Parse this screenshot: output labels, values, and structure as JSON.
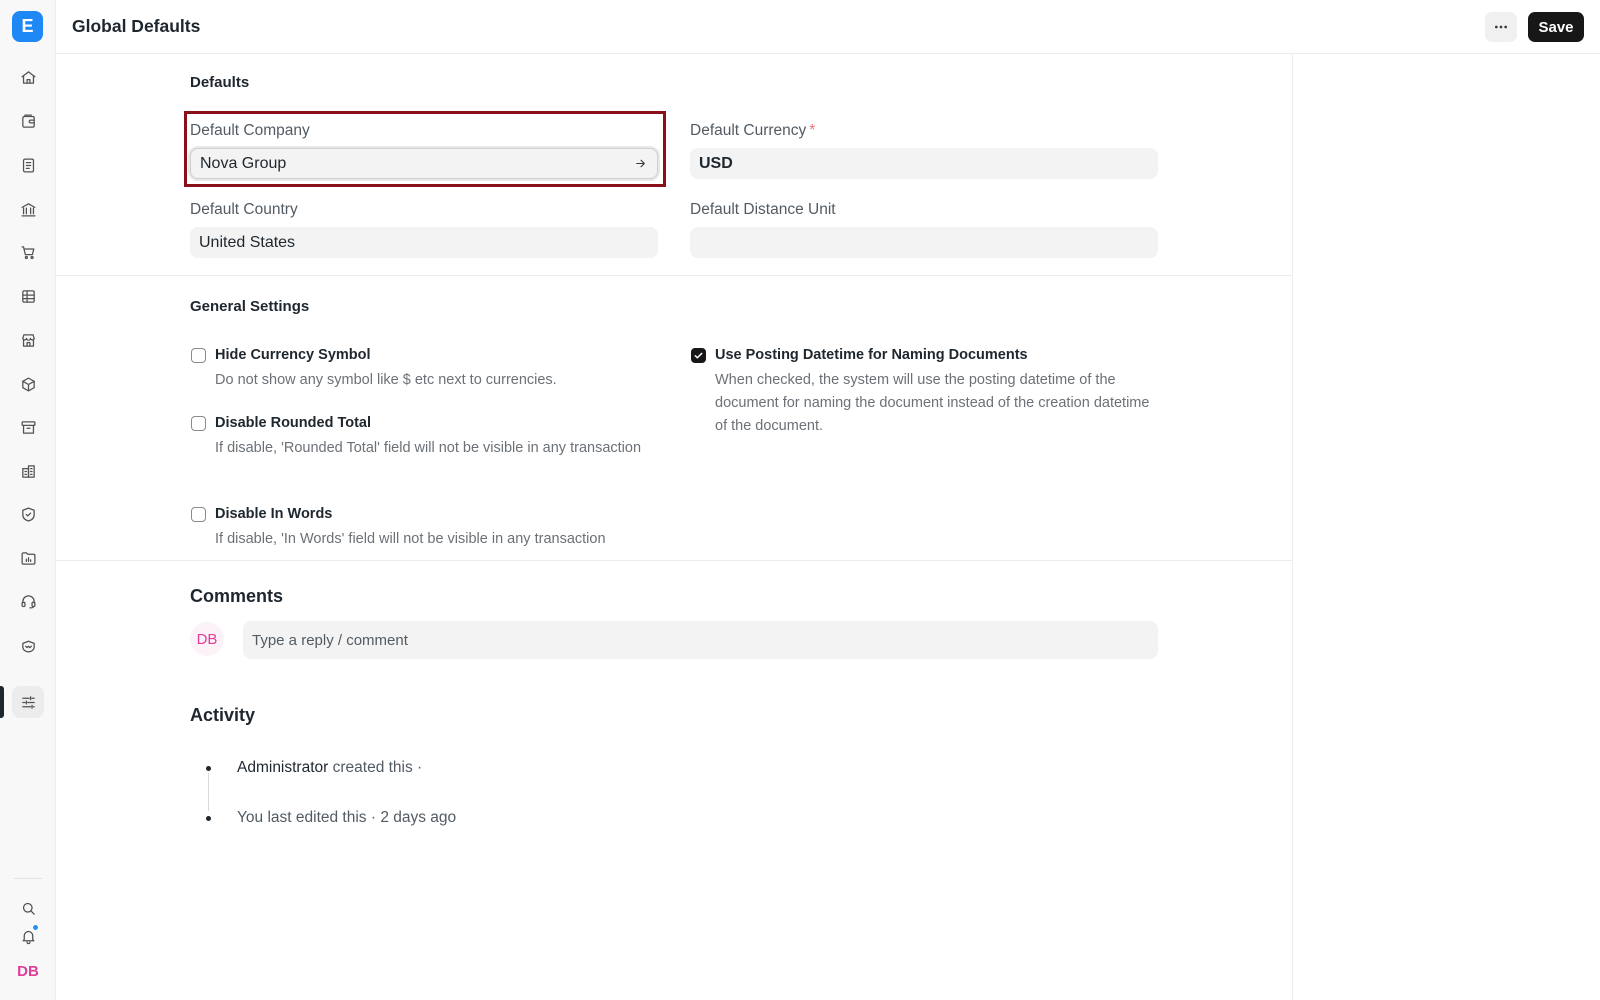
{
  "app": {
    "logo_letter": "E",
    "user_initials": "DB"
  },
  "sidebar": {
    "items": [
      {
        "name": "home-icon"
      },
      {
        "name": "wallet-icon"
      },
      {
        "name": "document-icon"
      },
      {
        "name": "bank-icon"
      },
      {
        "name": "cart-icon"
      },
      {
        "name": "table-icon"
      },
      {
        "name": "store-icon"
      },
      {
        "name": "package-icon"
      },
      {
        "name": "archive-icon"
      },
      {
        "name": "building-icon"
      },
      {
        "name": "shield-icon"
      },
      {
        "name": "folder-chart-icon"
      },
      {
        "name": "headset-icon"
      },
      {
        "name": "handshake-icon"
      },
      {
        "name": "sliders-icon",
        "active": true
      }
    ]
  },
  "header": {
    "title": "Global Defaults",
    "more_label": "···",
    "save_label": "Save"
  },
  "defaults": {
    "section_title": "Defaults",
    "default_company": {
      "label": "Default Company",
      "value": "Nova Group"
    },
    "default_currency": {
      "label": "Default Currency",
      "required_mark": "*",
      "value": "USD"
    },
    "default_country": {
      "label": "Default Country",
      "value": "United States"
    },
    "default_distance_unit": {
      "label": "Default Distance Unit",
      "value": ""
    }
  },
  "general_settings": {
    "section_title": "General Settings",
    "hide_currency_symbol": {
      "label": "Hide Currency Symbol",
      "description": "Do not show any symbol like $ etc next to currencies.",
      "checked": false
    },
    "disable_rounded_total": {
      "label": "Disable Rounded Total",
      "description": "If disable, 'Rounded Total' field will not be visible in any transaction",
      "checked": false
    },
    "disable_in_words": {
      "label": "Disable In Words",
      "description": "If disable, 'In Words' field will not be visible in any transaction",
      "checked": false
    },
    "use_posting_datetime": {
      "label": "Use Posting Datetime for Naming Documents",
      "description": "When checked, the system will use the posting datetime of the document for naming the document instead of the creation datetime of the document.",
      "checked": true
    }
  },
  "comments": {
    "title": "Comments",
    "avatar_initials": "DB",
    "placeholder": "Type a reply / comment"
  },
  "activity": {
    "title": "Activity",
    "entries": [
      {
        "actor": "Administrator",
        "text": "created this ·"
      },
      {
        "actor": "",
        "text": "You last edited this · 2 days ago"
      }
    ]
  },
  "colors": {
    "accent": "#1e88f5",
    "highlight": "#8b0f1a",
    "avatar": "#e03e9b"
  }
}
